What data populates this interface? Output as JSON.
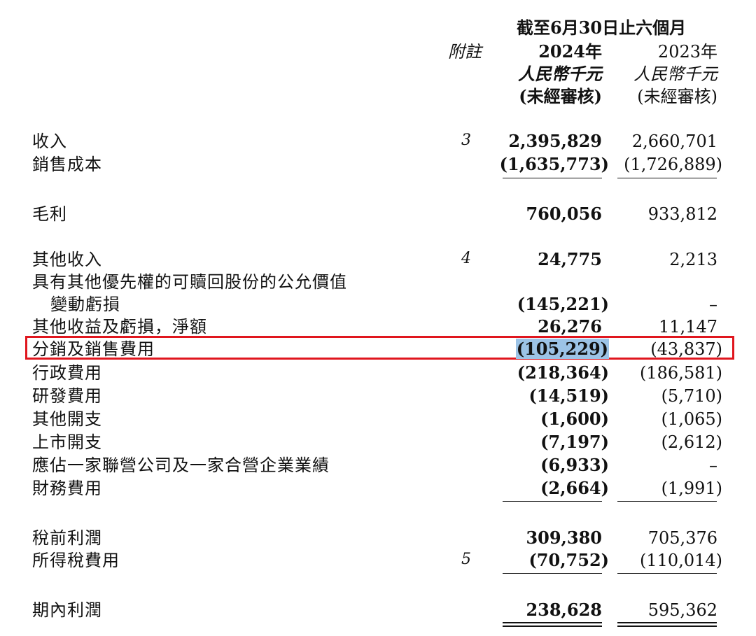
{
  "header": {
    "period": "截至6月30日止六個月",
    "note_label": "附註",
    "year_2024": "2024年",
    "year_2023": "2023年",
    "unit_2024": "人民幣千元",
    "unit_2023": "人民幣千元",
    "audit_2024": "(未經審核)",
    "audit_2023": "(未經審核)"
  },
  "rows": [
    {
      "label": "收入",
      "note": "3",
      "v2024": "2,395,829",
      "v2023": "2,660,701"
    },
    {
      "label": "銷售成本",
      "note": "",
      "v2024": "(1,635,773)",
      "v2023": "(1,726,889)"
    },
    {
      "label": "毛利",
      "note": "",
      "v2024": "760,056",
      "v2023": "933,812"
    },
    {
      "label": "其他收入",
      "note": "4",
      "v2024": "24,775",
      "v2023": "2,213"
    },
    {
      "label": "具有其他優先權的可贖回股份的公允價值",
      "label2": "變動虧損",
      "note": "",
      "v2024": "(145,221)",
      "v2023": "–"
    },
    {
      "label": "其他收益及虧損，淨額",
      "note": "",
      "v2024": "26,276",
      "v2023": "11,147"
    },
    {
      "label": "分銷及銷售費用",
      "note": "",
      "v2024": "(105,229)",
      "v2023": "(43,837)"
    },
    {
      "label": "行政費用",
      "note": "",
      "v2024": "(218,364)",
      "v2023": "(186,581)"
    },
    {
      "label": "研發費用",
      "note": "",
      "v2024": "(14,519)",
      "v2023": "(5,710)"
    },
    {
      "label": "其他開支",
      "note": "",
      "v2024": "(1,600)",
      "v2023": "(1,065)"
    },
    {
      "label": "上市開支",
      "note": "",
      "v2024": "(7,197)",
      "v2023": "(2,612)"
    },
    {
      "label": "應佔一家聯營公司及一家合營企業業績",
      "note": "",
      "v2024": "(6,933)",
      "v2023": "–"
    },
    {
      "label": "財務費用",
      "note": "",
      "v2024": "(2,664)",
      "v2023": "(1,991)"
    },
    {
      "label": "稅前利潤",
      "note": "",
      "v2024": "309,380",
      "v2023": "705,376"
    },
    {
      "label": "所得稅費用",
      "note": "5",
      "v2024": "(70,752)",
      "v2023": "(110,014)"
    },
    {
      "label": "期內利潤",
      "note": "",
      "v2024": "238,628",
      "v2023": "595,362"
    }
  ],
  "colors": {
    "highlight_box": "#e0161e",
    "selection": "#9cc3e6",
    "text": "#111111"
  }
}
